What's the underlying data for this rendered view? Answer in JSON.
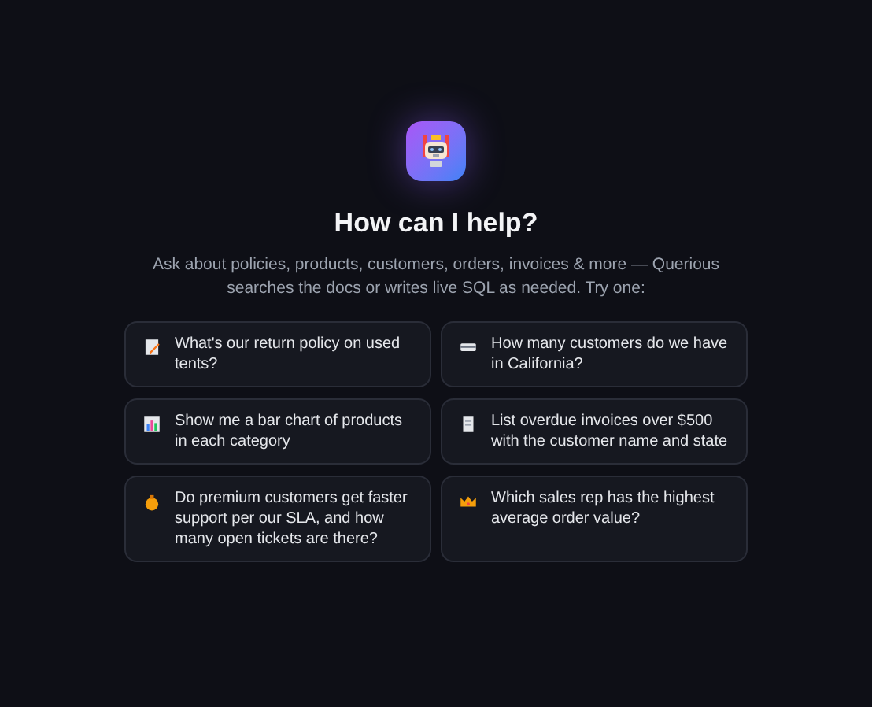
{
  "heading": "How can I help?",
  "subtitle": "Ask about policies, products, customers, orders, invoices & more — Querious searches the docs or writes live SQL as needed. Try one:",
  "suggestions": [
    {
      "text": "What's our return policy on used tents?"
    },
    {
      "text": "How many customers do we have in California?"
    },
    {
      "text": "Show me a bar chart of products in each category"
    },
    {
      "text": "List overdue invoices over $500 with the customer name and state"
    },
    {
      "text": "Do premium customers get faster support per our SLA, and how many open tickets are there?"
    },
    {
      "text": "Which sales rep has the highest average order value?"
    }
  ]
}
